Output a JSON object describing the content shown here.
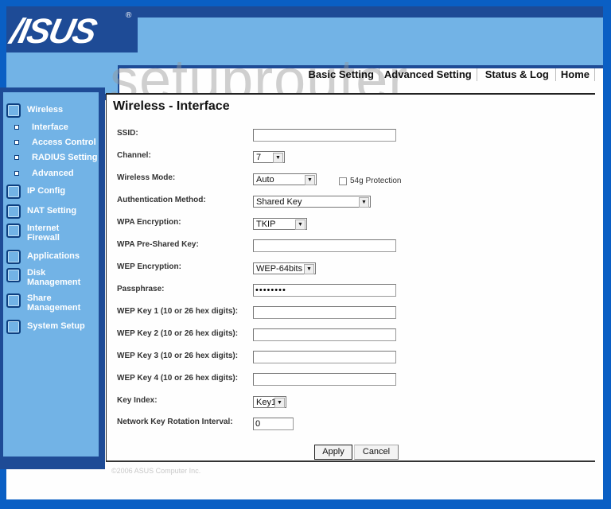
{
  "brand": {
    "logo": "/ISUS",
    "registered": "®"
  },
  "watermark": "setuprouter",
  "topnav": [
    "Basic Setting",
    "Advanced Setting",
    "Status & Log",
    "Home"
  ],
  "sidebar": {
    "items": [
      {
        "label": "Wireless",
        "icon": "square-icon"
      },
      {
        "label": "IP Config",
        "icon": "square-icon"
      },
      {
        "label": "NAT Setting",
        "icon": "square-icon"
      },
      {
        "label": "Internet Firewall",
        "icon": "square-icon"
      },
      {
        "label": "Applications",
        "icon": "square-icon"
      },
      {
        "label": "Disk Management",
        "icon": "square-icon"
      },
      {
        "label": "Share Management",
        "icon": "square-icon"
      },
      {
        "label": "System Setup",
        "icon": "square-icon"
      }
    ],
    "wireless_subitems": [
      "Interface",
      "Access Control",
      "RADIUS Setting",
      "Advanced"
    ]
  },
  "page": {
    "title": "Wireless - Interface",
    "fields": {
      "ssid": {
        "label": "SSID:",
        "value": ""
      },
      "channel": {
        "label": "Channel:",
        "value": "7"
      },
      "wireless_mode": {
        "label": "Wireless Mode:",
        "value": "Auto"
      },
      "protection": {
        "label": "54g Protection",
        "checked": false
      },
      "auth_method": {
        "label": "Authentication Method:",
        "value": "Shared Key"
      },
      "wpa_encryption": {
        "label": "WPA Encryption:",
        "value": "TKIP"
      },
      "wpa_psk": {
        "label": "WPA Pre-Shared Key:",
        "value": ""
      },
      "wep_encryption": {
        "label": "WEP Encryption:",
        "value": "WEP-64bits"
      },
      "passphrase": {
        "label": "Passphrase:",
        "value": "••••••••"
      },
      "wep_key1": {
        "label": "WEP Key 1 (10 or 26 hex digits):",
        "value": ""
      },
      "wep_key2": {
        "label": "WEP Key 2 (10 or 26 hex digits):",
        "value": ""
      },
      "wep_key3": {
        "label": "WEP Key 3 (10 or 26 hex digits):",
        "value": ""
      },
      "wep_key4": {
        "label": "WEP Key 4 (10 or 26 hex digits):",
        "value": ""
      },
      "key_index": {
        "label": "Key Index:",
        "value": "Key1"
      },
      "rotation_interval": {
        "label": "Network Key Rotation Interval:",
        "value": "0"
      }
    },
    "buttons": {
      "apply": "Apply",
      "cancel": "Cancel"
    }
  },
  "footer": "©2006 ASUS Computer Inc.",
  "colors": {
    "dark_blue": "#1e4b96",
    "light_blue": "#72b3e6",
    "outer_blue": "#0a5fc4"
  }
}
